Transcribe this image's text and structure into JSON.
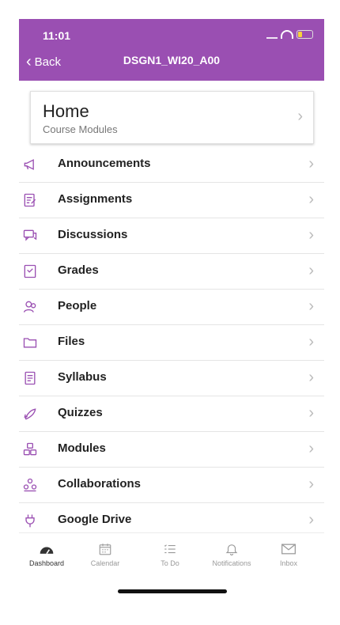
{
  "status_bar": {
    "time": "11:01"
  },
  "nav_bar": {
    "back_label": "Back",
    "title": "DSGN1_WI20_A00"
  },
  "home": {
    "title": "Home",
    "subtitle": "Course Modules"
  },
  "menu": [
    {
      "label": "Announcements",
      "icon": "megaphone-icon"
    },
    {
      "label": "Assignments",
      "icon": "assignment-icon"
    },
    {
      "label": "Discussions",
      "icon": "discussion-icon"
    },
    {
      "label": "Grades",
      "icon": "grades-icon"
    },
    {
      "label": "People",
      "icon": "people-icon"
    },
    {
      "label": "Files",
      "icon": "folder-icon"
    },
    {
      "label": "Syllabus",
      "icon": "syllabus-icon"
    },
    {
      "label": "Quizzes",
      "icon": "rocket-icon"
    },
    {
      "label": "Modules",
      "icon": "modules-icon"
    },
    {
      "label": "Collaborations",
      "icon": "collaborations-icon"
    },
    {
      "label": "Google Drive",
      "icon": "plug-icon"
    }
  ],
  "tabs": [
    {
      "label": "Dashboard",
      "icon": "dashboard-icon",
      "active": true
    },
    {
      "label": "Calendar",
      "icon": "calendar-icon",
      "active": false
    },
    {
      "label": "To Do",
      "icon": "todo-icon",
      "active": false
    },
    {
      "label": "Notifications",
      "icon": "bell-icon",
      "active": false
    },
    {
      "label": "Inbox",
      "icon": "inbox-icon",
      "active": false
    }
  ],
  "colors": {
    "brand": "#9a4fb2",
    "text": "#222222",
    "muted": "#777777"
  }
}
